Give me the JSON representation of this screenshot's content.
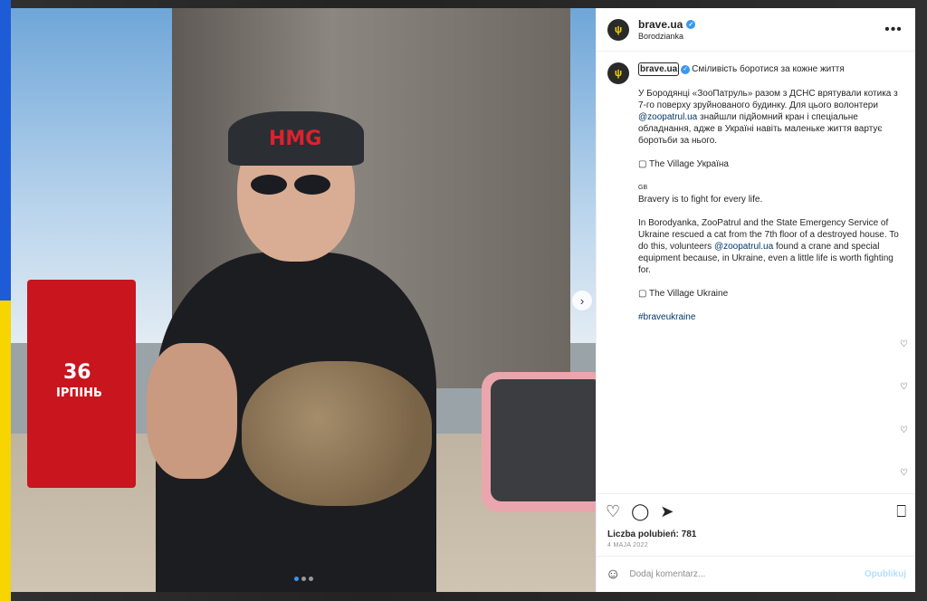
{
  "theme": {
    "accent": "#3897f0",
    "link": "#00376b",
    "ukraine_blue": "#1e5bd6",
    "ukraine_yellow": "#f6d500"
  },
  "post": {
    "username": "brave.ua",
    "location": "Borodzianka",
    "avatar_icon": "trident-icon",
    "more_icon": "more-horizontal-icon"
  },
  "media": {
    "truck_number": "36",
    "truck_city": "ІРПІНЬ",
    "cap_text": "HMG",
    "carousel_dots": 3,
    "active_dot": 1,
    "next_icon": "chevron-right-icon"
  },
  "caption": {
    "username": "brave.ua",
    "title": "Сміливість боротися за кожне життя",
    "uk_p1": "У Бородянці «ЗооПатруль» разом з ДСНС врятували котика з 7-го поверху зруйнованого будинку. Для цього волонтери",
    "uk_mention": "@zoopatrul.ua",
    "uk_p1_rest": "знайшли підйомний кран і спеціальне обладнання, адже в Україні навіть маленьке життя вартує боротьби за нього.",
    "uk_source": "The Village Україна",
    "gb_flag": "GB",
    "en_title": "Bravery is to fight for every life.",
    "en_p1": "In Borodyanka, ZooPatrul and the State Emergency Service of Ukraine rescued a cat from the 7th floor of a destroyed house. To do this, volunteers",
    "en_mention": "@zoopatrul.ua",
    "en_p1_rest": "found a crane and special equipment because, in Ukraine, even a little life is worth fighting for.",
    "en_source": "The Village Ukraine",
    "hashtag": "#braveukraine"
  },
  "actions": {
    "like_icon": "heart-icon",
    "comment_icon": "comment-icon",
    "share_icon": "send-icon",
    "save_icon": "bookmark-icon"
  },
  "likes": "Liczba polubień: 781",
  "date": "4 MAJA 2022",
  "comment_form": {
    "emoji_icon": "emoji-icon",
    "placeholder": "Dodaj komentarz...",
    "publish_label": "Opublikuj"
  }
}
